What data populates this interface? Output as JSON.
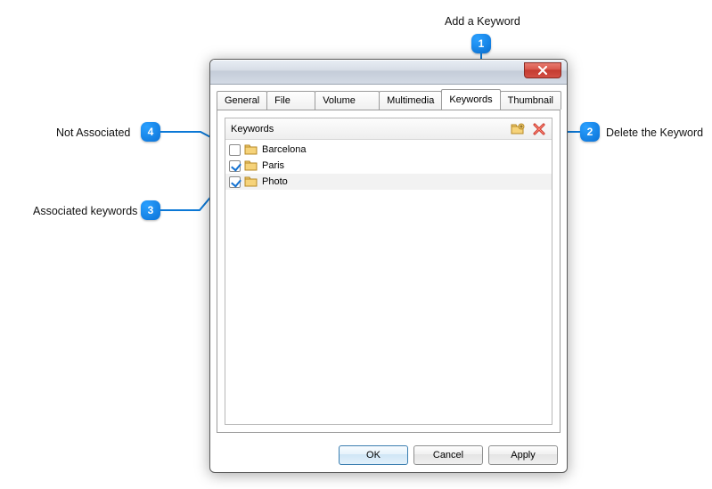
{
  "annotations": {
    "add": {
      "label": "Add a Keyword",
      "num": "1"
    },
    "delete": {
      "label": "Delete the Keyword",
      "num": "2"
    },
    "notAssoc": {
      "label": "Not Associated",
      "num": "4"
    },
    "assoc": {
      "label": "Associated keywords",
      "num": "3"
    }
  },
  "tabs": {
    "general": "General",
    "fileinfo": "File Info",
    "volumeinfo": "Volume Info",
    "multimedia": "Multimedia",
    "keywords": "Keywords",
    "thumbnail": "Thumbnail"
  },
  "panel": {
    "title": "Keywords"
  },
  "keywords": {
    "item0": {
      "label": "Barcelona"
    },
    "item1": {
      "label": "Paris"
    },
    "item2": {
      "label": "Photo"
    }
  },
  "buttons": {
    "ok": "OK",
    "cancel": "Cancel",
    "apply": "Apply"
  }
}
